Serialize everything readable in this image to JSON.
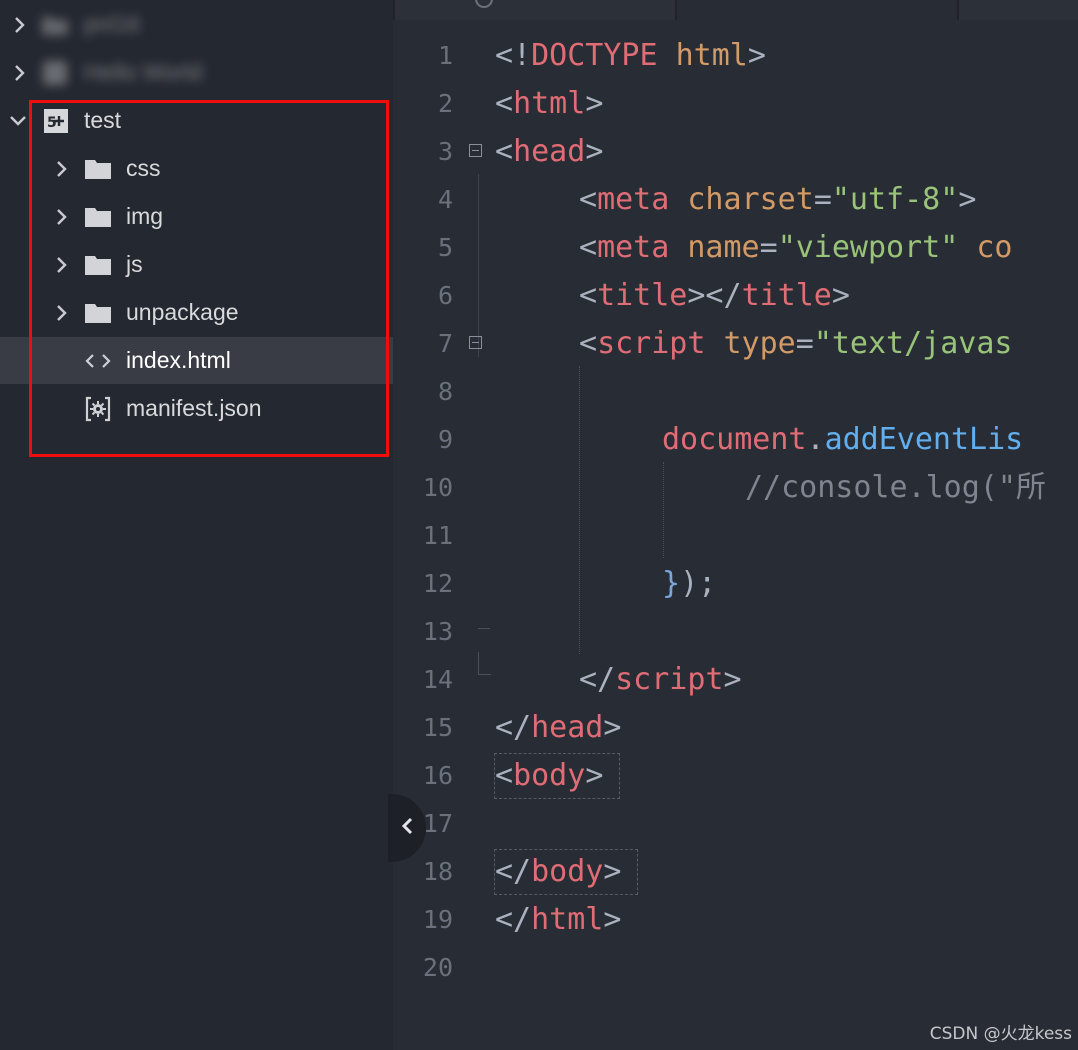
{
  "sidebar": {
    "blurred_items": [
      {
        "label": "pnl16"
      },
      {
        "label": "Hello World"
      }
    ],
    "project": {
      "name": "test",
      "icon": "5plus-project-icon"
    },
    "items": [
      {
        "label": "css",
        "type": "folder"
      },
      {
        "label": "img",
        "type": "folder"
      },
      {
        "label": "js",
        "type": "folder"
      },
      {
        "label": "unpackage",
        "type": "folder"
      },
      {
        "label": "index.html",
        "type": "html-file",
        "selected": true
      },
      {
        "label": "manifest.json",
        "type": "json-file"
      }
    ],
    "highlight_color": "#f20d0d"
  },
  "editor": {
    "lines": [
      {
        "n": "1"
      },
      {
        "n": "2"
      },
      {
        "n": "3"
      },
      {
        "n": "4"
      },
      {
        "n": "5"
      },
      {
        "n": "6"
      },
      {
        "n": "7"
      },
      {
        "n": "8"
      },
      {
        "n": "9"
      },
      {
        "n": "10"
      },
      {
        "n": "11"
      },
      {
        "n": "12"
      },
      {
        "n": "13"
      },
      {
        "n": "14"
      },
      {
        "n": "15"
      },
      {
        "n": "16"
      },
      {
        "n": "17"
      },
      {
        "n": "18"
      },
      {
        "n": "19"
      },
      {
        "n": "20"
      }
    ],
    "code": {
      "l1": {
        "a": "<!",
        "b": "DOCTYPE",
        "c": " ",
        "d": "html",
        "e": ">"
      },
      "l2": {
        "a": "<",
        "b": "html",
        "c": ">"
      },
      "l3": {
        "a": "<",
        "b": "head",
        "c": ">"
      },
      "l4": {
        "a": "<",
        "b": "meta",
        "c": " ",
        "d": "charset",
        "e": "=",
        "f": "\"utf-8\"",
        "g": ">"
      },
      "l5": {
        "a": "<",
        "b": "meta",
        "c": " ",
        "d": "name",
        "e": "=",
        "f": "\"viewport\"",
        "g": " ",
        "h": "co"
      },
      "l6": {
        "a": "<",
        "b": "title",
        "c": "></",
        "d": "title",
        "e": ">"
      },
      "l7": {
        "a": "<",
        "b": "script",
        "c": " ",
        "d": "type",
        "e": "=",
        "f": "\"text/javas"
      },
      "l9": {
        "a": "document",
        "b": ".",
        "c": "addEventLis"
      },
      "l10": {
        "a": "//console.log(\"所"
      },
      "l12": {
        "a": "}",
        "b": ");"
      },
      "l14": {
        "a": "</",
        "b": "script",
        "c": ">"
      },
      "l15": {
        "a": "</",
        "b": "head",
        "c": ">"
      },
      "l16": {
        "a": "<",
        "b": "body",
        "c": ">"
      },
      "l18": {
        "a": "</",
        "b": "body",
        "c": ">"
      },
      "l19": {
        "a": "</",
        "b": "html",
        "c": ">"
      }
    }
  },
  "watermark": "CSDN @火龙kess"
}
